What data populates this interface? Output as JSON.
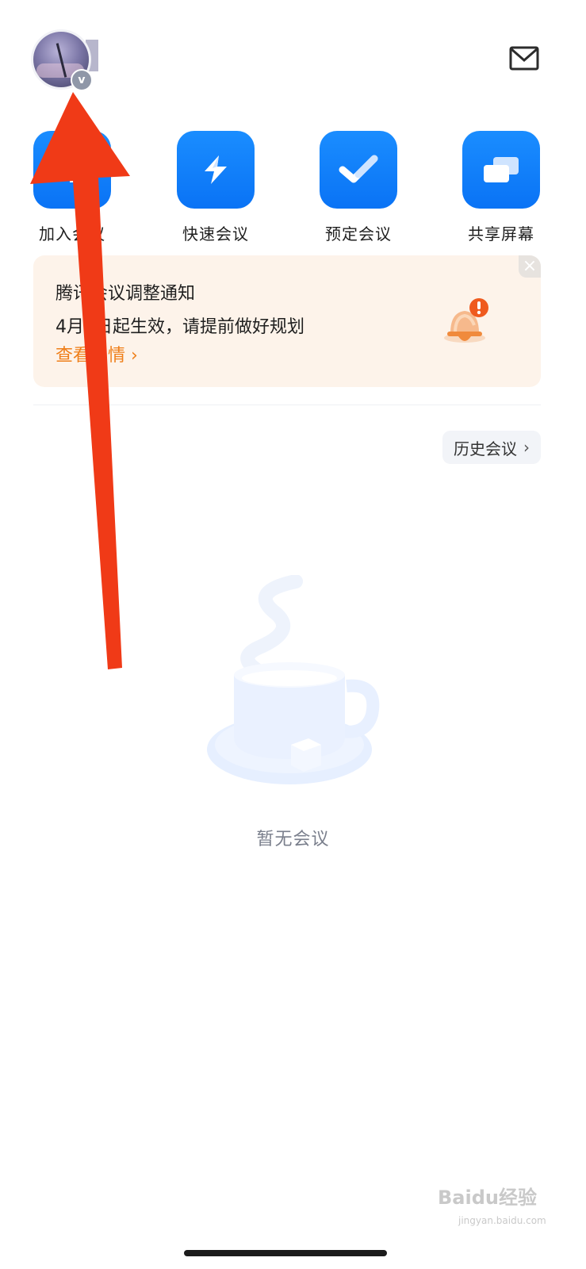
{
  "actions": [
    {
      "label": "加入会议",
      "icon": "plus-icon"
    },
    {
      "label": "快速会议",
      "icon": "lightning-icon"
    },
    {
      "label": "预定会议",
      "icon": "checkmark-icon"
    },
    {
      "label": "共享屏幕",
      "icon": "share-screen-icon"
    }
  ],
  "notice": {
    "title": "腾讯会议调整通知",
    "body": "4月1日起生效，请提前做好规划",
    "link": "查看详情 ›",
    "close": "×"
  },
  "history": {
    "label": "历史会议",
    "chevron": "›"
  },
  "empty": {
    "text": "暂无会议"
  },
  "avatar": {
    "badge": "v"
  },
  "watermark": {
    "text": "Baidu经验",
    "sub": "jingyan.baidu.com"
  },
  "colors": {
    "accent": "#0a73f5",
    "notice_bg": "#fdf3ea",
    "notice_link": "#ef7f1a",
    "annotation_arrow": "#f03a17"
  }
}
